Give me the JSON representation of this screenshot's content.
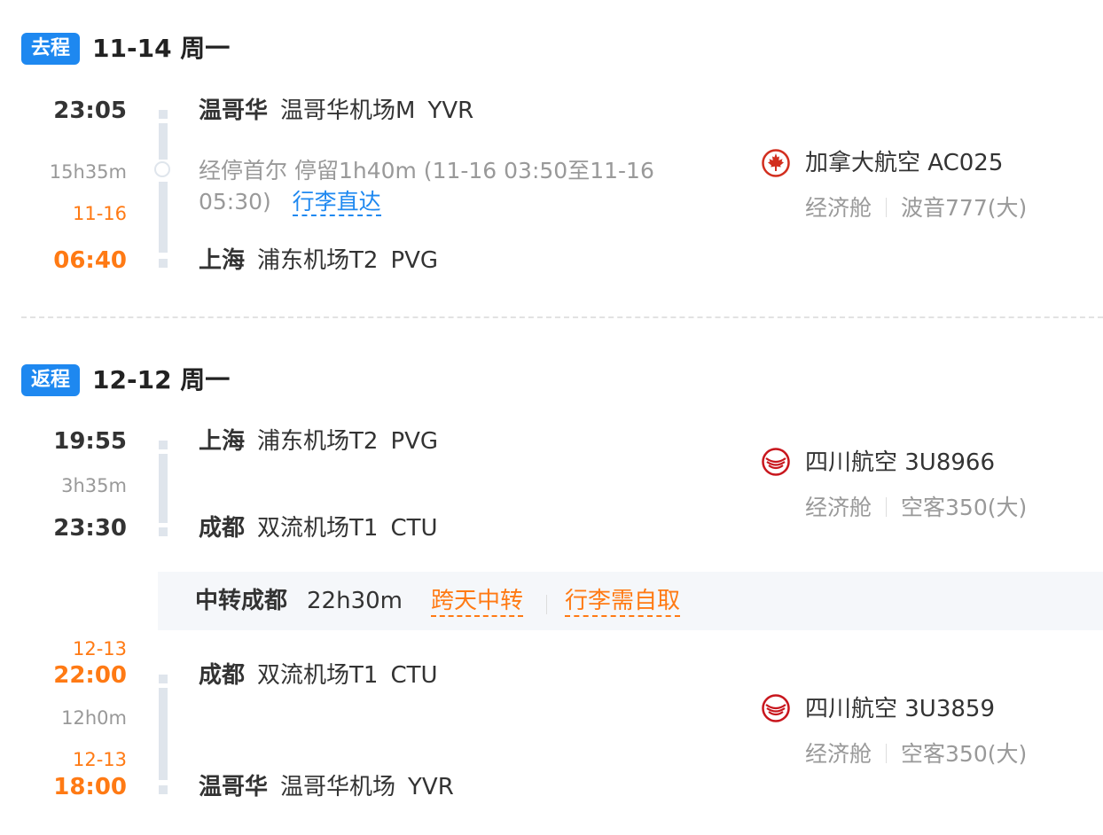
{
  "outbound": {
    "badge": "去程",
    "date": "11-14 周一",
    "dep_time": "23:05",
    "duration": "15h35m",
    "arr_date": "11-16",
    "arr_time": "06:40",
    "dep_city": "温哥华",
    "dep_airport": "温哥华机场M",
    "dep_code": "YVR",
    "stop_text": "经停首尔  停留1h40m  (11-16 03:50至11-16 05:30)",
    "baggage_link": "行李直达",
    "arr_city": "上海",
    "arr_airport": "浦东机场T2",
    "arr_code": "PVG",
    "airline": "加拿大航空 AC025",
    "cabin": "经济舱",
    "aircraft": "波音777(大)"
  },
  "return": {
    "badge": "返程",
    "date": "12-12 周一",
    "leg1": {
      "dep_time": "19:55",
      "duration": "3h35m",
      "arr_time": "23:30",
      "dep_city": "上海",
      "dep_airport": "浦东机场T2",
      "dep_code": "PVG",
      "arr_city": "成都",
      "arr_airport": "双流机场T1",
      "arr_code": "CTU",
      "airline": "四川航空 3U8966",
      "cabin": "经济舱",
      "aircraft": "空客350(大)"
    },
    "transfer": {
      "city": "中转成都",
      "duration": "22h30m",
      "tag1": "跨天中转",
      "tag2": "行李需自取"
    },
    "leg2": {
      "dep_date": "12-13",
      "dep_time": "22:00",
      "duration": "12h0m",
      "arr_date": "12-13",
      "arr_time": "18:00",
      "dep_city": "成都",
      "dep_airport": "双流机场T1",
      "dep_code": "CTU",
      "arr_city": "温哥华",
      "arr_airport": "温哥华机场",
      "arr_code": "YVR",
      "airline": "四川航空 3U3859",
      "cabin": "经济舱",
      "aircraft": "空客350(大)"
    }
  },
  "colors": {
    "accent_blue": "#1e88f0",
    "accent_orange": "#ff7a14",
    "aircanada_red": "#d22e1e",
    "sichuan_red": "#c8161d"
  }
}
